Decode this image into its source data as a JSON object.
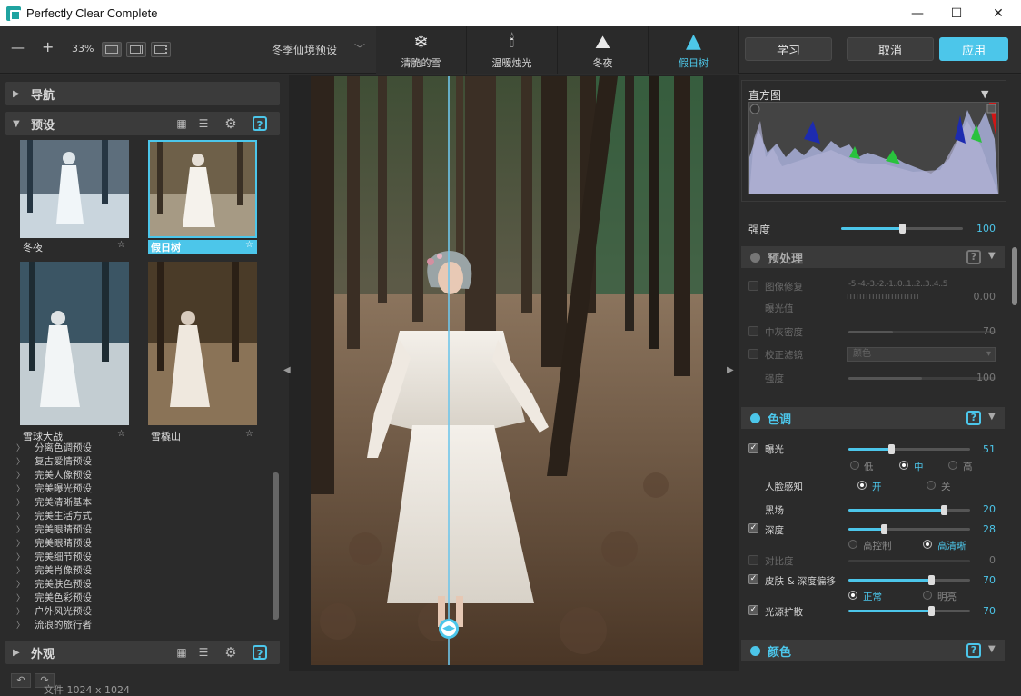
{
  "window": {
    "title": "Perfectly Clear Complete",
    "minimize_glyph": "—",
    "maximize_glyph": "☐",
    "close_glyph": "✕"
  },
  "toolbar": {
    "zoom_out": "—",
    "zoom_in": "+",
    "zoom_level": "33%",
    "preset_name": "冬季仙境预设",
    "preset_strip": [
      {
        "label": "清脆的雪",
        "icon": "snowflake-icon",
        "glyph": "❄",
        "active": false
      },
      {
        "label": "温暖烛光",
        "icon": "candle-icon",
        "glyph": "🕯",
        "active": false
      },
      {
        "label": "冬夜",
        "icon": "mountain-moon-icon",
        "glyph": "⛰",
        "active": false
      },
      {
        "label": "假日树",
        "icon": "christmas-tree-icon",
        "glyph": "▲",
        "active": true
      }
    ],
    "learn_label": "学习",
    "cancel_label": "取消",
    "apply_label": "应用"
  },
  "left": {
    "nav_title": "导航",
    "presets_title": "预设",
    "help_glyph": "?",
    "thumbnails": [
      {
        "label": "冬夜",
        "selected": false
      },
      {
        "label": "假日树",
        "selected": true
      },
      {
        "label": "雪球大战",
        "selected": false
      },
      {
        "label": "雪橇山",
        "selected": false
      }
    ],
    "star_glyph": "☆",
    "preset_groups": [
      "分离色调预设",
      "复古爱情预设",
      "完美人像预设",
      "完美曝光预设",
      "完美清晰基本",
      "完美生活方式",
      "完美眼睛预设",
      "完美眼睛预设",
      "完美细节预设",
      "完美肖像预设",
      "完美肤色预设",
      "完美色彩预设",
      "户外风光预设",
      "流浪的旅行者"
    ],
    "appearance_title": "外观"
  },
  "right": {
    "histogram_title": "直方图",
    "strength_label": "强度",
    "strength_value": "100",
    "strength_level": 0.5,
    "preprocess": {
      "title": "预处理",
      "image_repair": "图像修复",
      "exposure_label": "曝光值",
      "scale": "-5.-4.-3.-2.-1..0..1..2..3..4..5",
      "exposure_value": "0.00",
      "neutral_density": "中灰密度",
      "neutral_density_value": "70",
      "neutral_density_level": 0.3,
      "correction_lens": "校正滤镜",
      "correction_option": "颜色",
      "strength_label": "强度",
      "strength_value": "100",
      "strength_level": 0.5
    },
    "tone": {
      "title": "色调",
      "exposure": "曝光",
      "exposure_value": "51",
      "exposure_level": 0.35,
      "exp_low": "低",
      "exp_mid": "中",
      "exp_high": "高",
      "face_aware": "人脸感知",
      "face_on": "开",
      "face_off": "关",
      "black_point": "黑场",
      "black_point_value": "20",
      "black_point_level": 0.78,
      "depth": "深度",
      "depth_value": "28",
      "depth_level": 0.29,
      "depth_hc": "高控制",
      "depth_hd": "高清晰",
      "contrast": "对比度",
      "contrast_value": "0",
      "skin_depth": "皮肤 & 深度偏移",
      "skin_depth_value": "70",
      "skin_depth_level": 0.68,
      "skin_normal": "正常",
      "skin_bright": "明亮",
      "light_diffusion": "光源扩散",
      "light_diffusion_value": "70",
      "light_diffusion_level": 0.68
    },
    "color": {
      "title": "颜色"
    }
  },
  "status": {
    "undo_glyph": "↶",
    "redo_glyph": "↷",
    "file_info": "文件 1024 x 1024"
  },
  "colors": {
    "accent": "#4cc6ea",
    "panel": "#2b2b2b",
    "section": "#3a3a3a"
  }
}
